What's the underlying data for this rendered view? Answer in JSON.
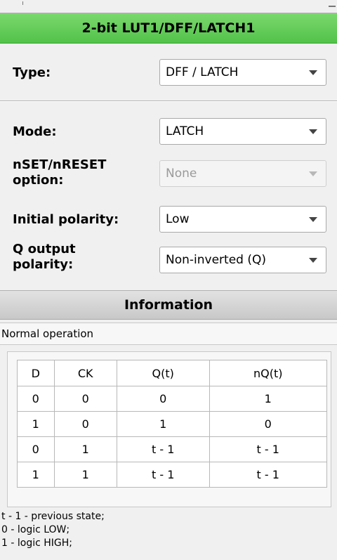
{
  "panel": {
    "title": "2-bit LUT1/DFF/LATCH1",
    "type_label": "Type:",
    "type_value": "DFF / LATCH",
    "mode_label": "Mode:",
    "mode_value": "LATCH",
    "nset_label_line1": "nSET/nRESET",
    "nset_label_line2": "option:",
    "nset_value": "None",
    "initial_label": "Initial polarity:",
    "initial_value": "Low",
    "qout_label_line1": "Q output",
    "qout_label_line2": "polarity:",
    "qout_value": "Non-inverted (Q)"
  },
  "information": {
    "header": "Information",
    "status": "Normal operation"
  },
  "truth_table": {
    "columns": [
      "D",
      "CK",
      "Q(t)",
      "nQ(t)"
    ],
    "rows": [
      [
        "0",
        "0",
        "0",
        "1"
      ],
      [
        "1",
        "0",
        "1",
        "0"
      ],
      [
        "0",
        "1",
        "t - 1",
        "t - 1"
      ],
      [
        "1",
        "1",
        "t - 1",
        "t - 1"
      ]
    ]
  },
  "legend": [
    "t - 1 - previous state;",
    "0 - logic LOW;",
    "1 - logic HIGH;"
  ]
}
